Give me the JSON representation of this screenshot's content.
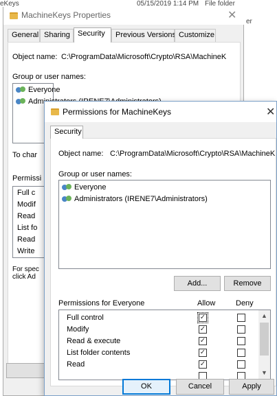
{
  "background": {
    "left_text": "eKeys",
    "date_text": "05/15/2019 1:14 PM",
    "type_text": "File folder",
    "right_text": "er"
  },
  "back_dialog": {
    "title": "MachineKeys Properties",
    "tabs": [
      "General",
      "Sharing",
      "Security",
      "Previous Versions",
      "Customize"
    ],
    "active_tab": "Security",
    "object_label": "Object name:",
    "object_value": "C:\\ProgramData\\Microsoft\\Crypto\\RSA\\MachineK",
    "group_label": "Group or user names:",
    "users": [
      "Everyone",
      "Administrators (IRENE7\\Administrators)"
    ],
    "to_change": "To char",
    "perm_header": "Permissi",
    "perm_items": [
      "Full c",
      "Modif",
      "Read",
      "List fo",
      "Read",
      "Write"
    ],
    "special_1": "For spec",
    "special_2": "click Ad"
  },
  "front_dialog": {
    "title": "Permissions for MachineKeys",
    "tab": "Security",
    "object_label": "Object name:",
    "object_value": "C:\\ProgramData\\Microsoft\\Crypto\\RSA\\MachineK",
    "group_label": "Group or user names:",
    "users": [
      {
        "name": "Everyone"
      },
      {
        "name": "Administrators (IRENE7\\Administrators)"
      }
    ],
    "add_label": "Add...",
    "remove_label": "Remove",
    "perm_for": "Permissions for Everyone",
    "allow_label": "Allow",
    "deny_label": "Deny",
    "permissions": [
      {
        "name": "Full control",
        "allow": true,
        "deny": false
      },
      {
        "name": "Modify",
        "allow": true,
        "deny": false
      },
      {
        "name": "Read & execute",
        "allow": true,
        "deny": false
      },
      {
        "name": "List folder contents",
        "allow": true,
        "deny": false
      },
      {
        "name": "Read",
        "allow": true,
        "deny": false
      }
    ],
    "ok_label": "OK",
    "cancel_label": "Cancel",
    "apply_label": "Apply"
  },
  "icons": {
    "check": "✓",
    "close": "✕",
    "scroll_up": "▲",
    "scroll_down": "▼"
  }
}
